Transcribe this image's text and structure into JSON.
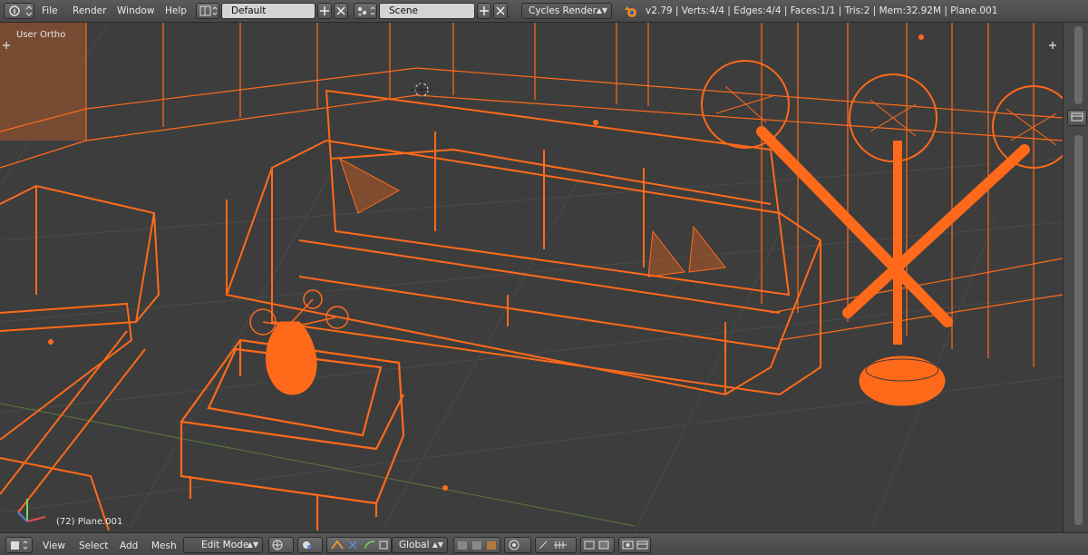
{
  "header": {
    "menu": [
      "File",
      "Render",
      "Window",
      "Help"
    ],
    "screen_layout": "Default",
    "scene": "Scene",
    "render_engine": "Cycles Render",
    "stats": "v2.79 | Verts:4/4 | Edges:4/4 | Faces:1/1 | Tris:2 | Mem:32.92M | Plane.001"
  },
  "viewport": {
    "view_label": "User Ortho",
    "object_label": "(72) Plane.001",
    "wire_color": "#ff6a1a",
    "background_color": "#3d3d3d"
  },
  "footer": {
    "menu": [
      "View",
      "Select",
      "Add",
      "Mesh"
    ],
    "mode": "Edit Mode",
    "orientation": "Global"
  },
  "icons": [
    "editor-type-icon",
    "info-icon",
    "screen-layout-icon",
    "add-icon",
    "close-icon",
    "scene-icon",
    "blender-logo-icon",
    "pivot-icon",
    "shading-icon",
    "manipulator-icon",
    "snap-icon",
    "proportional-edit-icon",
    "render-icon"
  ]
}
